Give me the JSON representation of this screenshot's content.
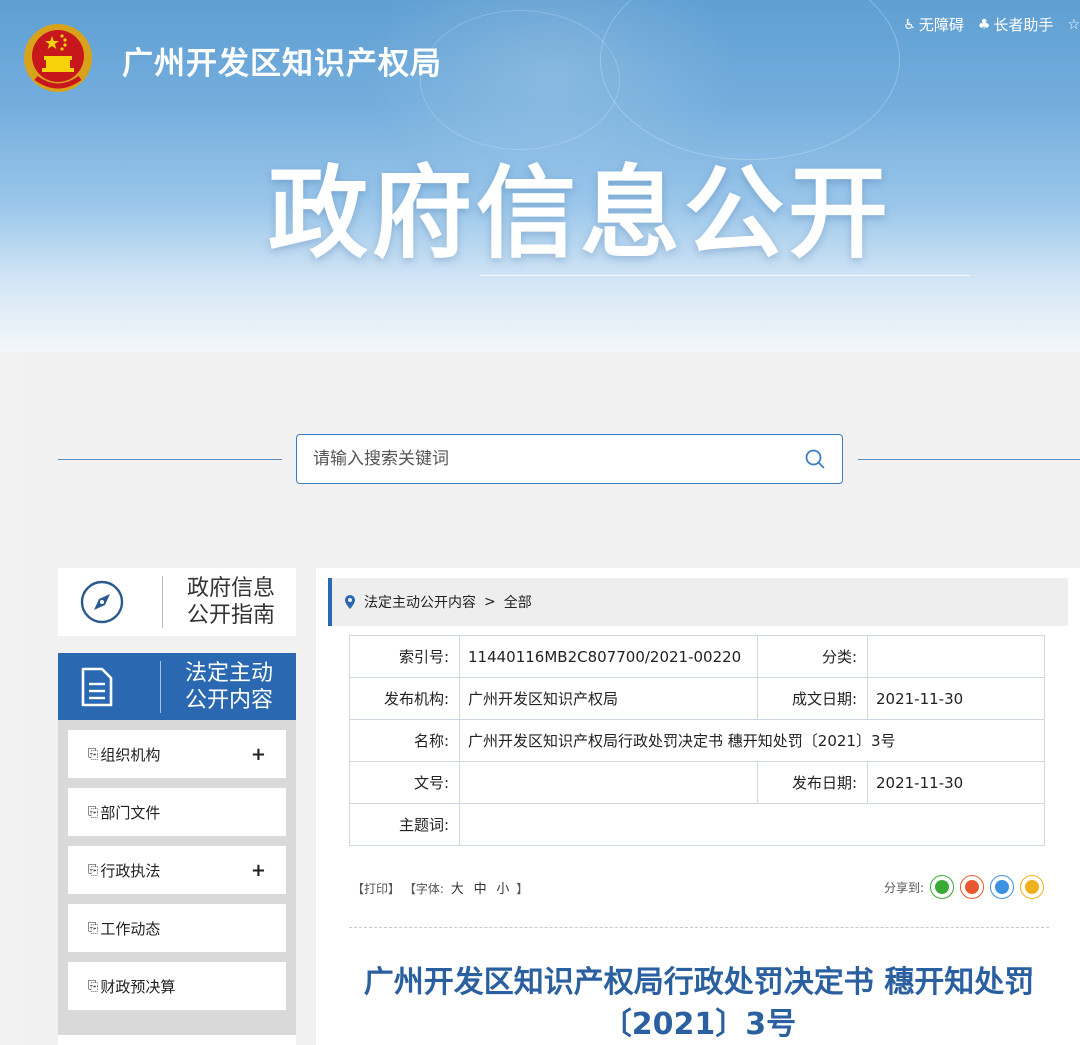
{
  "header": {
    "site_title": "广州开发区知识产权局",
    "hero_title": "政府信息公开",
    "top_links": [
      {
        "icon": "wheelchair-icon",
        "label": "无障碍"
      },
      {
        "icon": "elder-icon",
        "label": "长者助手"
      },
      {
        "icon": "star-icon",
        "label": ""
      }
    ]
  },
  "search": {
    "placeholder": "请输入搜索关键词"
  },
  "sidebar": {
    "guide_label": "政府信息公开指南",
    "law_label": "法定主动公开内容",
    "items": [
      {
        "label": "组织机构",
        "expandable": "+"
      },
      {
        "label": "部门文件",
        "expandable": ""
      },
      {
        "label": "行政执法",
        "expandable": "+"
      },
      {
        "label": "工作动态",
        "expandable": ""
      },
      {
        "label": "财政预决算",
        "expandable": ""
      }
    ]
  },
  "breadcrumb": {
    "section": "法定主动公开内容",
    "separator": ">",
    "current": "全部"
  },
  "meta": {
    "index_key": "索引号:",
    "index_val": "11440116MB2C807700/2021-00220",
    "category_key": "分类:",
    "category_val": "",
    "publisher_key": "发布机构:",
    "publisher_val": "广州开发区知识产权局",
    "written_date_key": "成文日期:",
    "written_date_val": "2021-11-30",
    "name_key": "名称:",
    "name_val": "广州开发区知识产权局行政处罚决定书 穗开知处罚〔2021〕3号",
    "docno_key": "文号:",
    "docno_val": "",
    "publish_date_key": "发布日期:",
    "publish_date_val": "2021-11-30",
    "keywords_key": "主题词:",
    "keywords_val": ""
  },
  "tools": {
    "print": "【打印】",
    "font_prefix": "【字体:",
    "font_large": "大",
    "font_medium": "中",
    "font_small": "小",
    "font_suffix": "】",
    "share_label": "分享到:"
  },
  "colors": {
    "primary": "#2a69b1",
    "title": "#2a5fa0",
    "wechat": "#3aa936",
    "weibo": "#e8582f",
    "qq": "#3c92e0",
    "qzone": "#f0b21c"
  },
  "article": {
    "title": "广州开发区知识产权局行政处罚决定书 穗开知处罚〔2021〕3号"
  }
}
